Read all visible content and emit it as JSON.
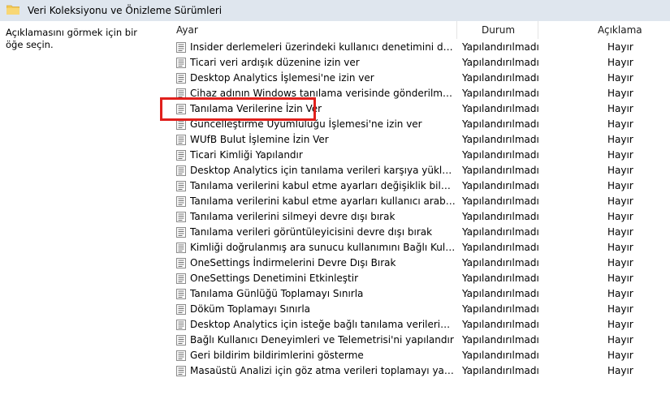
{
  "window": {
    "title": "Veri Koleksiyonu ve Önizleme Sürümleri",
    "folder_icon": "folder-icon"
  },
  "left_pane": {
    "description": "Açıklamasını görmek için bir öğe seçin."
  },
  "columns": {
    "setting": "Ayar",
    "state": "Durum",
    "comment": "Açıklama"
  },
  "rows": [
    {
      "name": "Insider derlemeleri üzerindeki kullanıcı denetimini değiştir",
      "state": "Yapılandırılmadı",
      "comment": "Hayır"
    },
    {
      "name": "Ticari veri ardışık düzenine izin ver",
      "state": "Yapılandırılmadı",
      "comment": "Hayır"
    },
    {
      "name": "Desktop Analytics İşlemesi'ne izin ver",
      "state": "Yapılandırılmadı",
      "comment": "Hayır"
    },
    {
      "name": "Cihaz adının Windows tanılama verisinde gönderilmesine izin ver",
      "state": "Yapılandırılmadı",
      "comment": "Hayır"
    },
    {
      "name": "Tanılama Verilerine İzin Ver",
      "state": "Yapılandırılmadı",
      "comment": "Hayır"
    },
    {
      "name": "Güncelleştirme Uyumluluğu İşlemesi'ne izin ver",
      "state": "Yapılandırılmadı",
      "comment": "Hayır"
    },
    {
      "name": "WUfB Bulut İşlemine İzin Ver",
      "state": "Yapılandırılmadı",
      "comment": "Hayır"
    },
    {
      "name": "Ticari Kimliği Yapılandır",
      "state": "Yapılandırılmadı",
      "comment": "Hayır"
    },
    {
      "name": "Desktop Analytics için tanılama verileri karşıya yükleme uç noktasını yapılandır",
      "state": "Yapılandırılmadı",
      "comment": "Hayır"
    },
    {
      "name": "Tanılama verilerini kabul etme ayarları değişiklik bildirimlerini yapılandır",
      "state": "Yapılandırılmadı",
      "comment": "Hayır"
    },
    {
      "name": "Tanılama verilerini kabul etme ayarları kullanıcı arabirimini yapılandır",
      "state": "Yapılandırılmadı",
      "comment": "Hayır"
    },
    {
      "name": "Tanılama verilerini silmeyi devre dışı bırak",
      "state": "Yapılandırılmadı",
      "comment": "Hayır"
    },
    {
      "name": "Tanılama verileri görüntüleyicisini devre dışı bırak",
      "state": "Yapılandırılmadı",
      "comment": "Hayır"
    },
    {
      "name": "Kimliği doğrulanmış ara sunucu kullanımını Bağlı Kullanıcı Deneyimi ve Telemetri hizmeti için yapılandır",
      "state": "Yapılandırılmadı",
      "comment": "Hayır"
    },
    {
      "name": "OneSettings İndirmelerini Devre Dışı Bırak",
      "state": "Yapılandırılmadı",
      "comment": "Hayır"
    },
    {
      "name": "OneSettings Denetimini Etkinleştir",
      "state": "Yapılandırılmadı",
      "comment": "Hayır"
    },
    {
      "name": "Tanılama Günlüğü Toplamayı Sınırla",
      "state": "Yapılandırılmadı",
      "comment": "Hayır"
    },
    {
      "name": "Döküm Toplamayı Sınırla",
      "state": "Yapılandırılmadı",
      "comment": "Hayır"
    },
    {
      "name": "Desktop Analytics için isteğe bağlı tanılama verilerini sınırla",
      "state": "Yapılandırılmadı",
      "comment": "Hayır"
    },
    {
      "name": "Bağlı Kullanıcı Deneyimleri ve Telemetrisi'ni yapılandır",
      "state": "Yapılandırılmadı",
      "comment": "Hayır"
    },
    {
      "name": "Geri bildirim bildirimlerini gösterme",
      "state": "Yapılandırılmadı",
      "comment": "Hayır"
    },
    {
      "name": "Masaüstü Analizi için göz atma verileri toplamayı yapılandır",
      "state": "Yapılandırılmadı",
      "comment": "Hayır"
    }
  ],
  "highlight_color": "#e0201c"
}
